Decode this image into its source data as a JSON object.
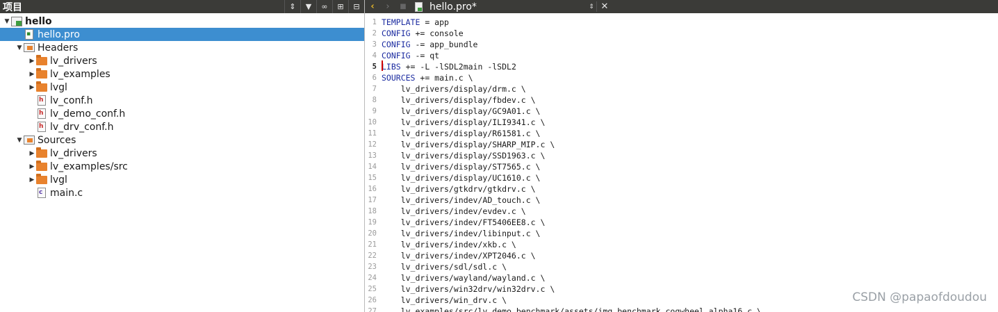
{
  "project_panel": {
    "title": "项目",
    "toolbar_icons": [
      "sort-spinner-icon",
      "filter-icon",
      "link-icon",
      "split-icon",
      "collapse-icon"
    ],
    "tree": [
      {
        "label": "hello",
        "depth": 0,
        "expand": "open",
        "icon": "project",
        "bold": true
      },
      {
        "label": "hello.pro",
        "depth": 1,
        "expand": "none",
        "icon": "pro-file",
        "selected": true
      },
      {
        "label": "Headers",
        "depth": 1,
        "expand": "open",
        "icon": "virtual-folder"
      },
      {
        "label": "lv_drivers",
        "depth": 2,
        "expand": "closed",
        "icon": "folder"
      },
      {
        "label": "lv_examples",
        "depth": 2,
        "expand": "closed",
        "icon": "folder"
      },
      {
        "label": "lvgl",
        "depth": 2,
        "expand": "closed",
        "icon": "folder"
      },
      {
        "label": "lv_conf.h",
        "depth": 2,
        "expand": "none",
        "icon": "h-file"
      },
      {
        "label": "lv_demo_conf.h",
        "depth": 2,
        "expand": "none",
        "icon": "h-file"
      },
      {
        "label": "lv_drv_conf.h",
        "depth": 2,
        "expand": "none",
        "icon": "h-file"
      },
      {
        "label": "Sources",
        "depth": 1,
        "expand": "open",
        "icon": "virtual-folder"
      },
      {
        "label": "lv_drivers",
        "depth": 2,
        "expand": "closed",
        "icon": "folder"
      },
      {
        "label": "lv_examples/src",
        "depth": 2,
        "expand": "closed",
        "icon": "folder"
      },
      {
        "label": "lvgl",
        "depth": 2,
        "expand": "closed",
        "icon": "folder"
      },
      {
        "label": "main.c",
        "depth": 2,
        "expand": "none",
        "icon": "c-file"
      }
    ]
  },
  "editor": {
    "tab_title": "hello.pro*",
    "current_line": 5,
    "lines": [
      {
        "n": "1",
        "kw": "TEMPLATE",
        "rest": " = app"
      },
      {
        "n": "2",
        "kw": "CONFIG",
        "rest": " += console"
      },
      {
        "n": "3",
        "kw": "CONFIG",
        "rest": " -= app_bundle"
      },
      {
        "n": "4",
        "kw": "CONFIG",
        "rest": " -= qt"
      },
      {
        "n": "5",
        "kw": "LIBS",
        "rest": " += -L -lSDL2main -lSDL2"
      },
      {
        "n": "6",
        "kw": "SOURCES",
        "rest": " += main.c \\"
      },
      {
        "n": "7",
        "kw": "",
        "rest": "    lv_drivers/display/drm.c \\"
      },
      {
        "n": "8",
        "kw": "",
        "rest": "    lv_drivers/display/fbdev.c \\"
      },
      {
        "n": "9",
        "kw": "",
        "rest": "    lv_drivers/display/GC9A01.c \\"
      },
      {
        "n": "10",
        "kw": "",
        "rest": "    lv_drivers/display/ILI9341.c \\"
      },
      {
        "n": "11",
        "kw": "",
        "rest": "    lv_drivers/display/R61581.c \\"
      },
      {
        "n": "12",
        "kw": "",
        "rest": "    lv_drivers/display/SHARP_MIP.c \\"
      },
      {
        "n": "13",
        "kw": "",
        "rest": "    lv_drivers/display/SSD1963.c \\"
      },
      {
        "n": "14",
        "kw": "",
        "rest": "    lv_drivers/display/ST7565.c \\"
      },
      {
        "n": "15",
        "kw": "",
        "rest": "    lv_drivers/display/UC1610.c \\"
      },
      {
        "n": "16",
        "kw": "",
        "rest": "    lv_drivers/gtkdrv/gtkdrv.c \\"
      },
      {
        "n": "17",
        "kw": "",
        "rest": "    lv_drivers/indev/AD_touch.c \\"
      },
      {
        "n": "18",
        "kw": "",
        "rest": "    lv_drivers/indev/evdev.c \\"
      },
      {
        "n": "19",
        "kw": "",
        "rest": "    lv_drivers/indev/FT5406EE8.c \\"
      },
      {
        "n": "20",
        "kw": "",
        "rest": "    lv_drivers/indev/libinput.c \\"
      },
      {
        "n": "21",
        "kw": "",
        "rest": "    lv_drivers/indev/xkb.c \\"
      },
      {
        "n": "22",
        "kw": "",
        "rest": "    lv_drivers/indev/XPT2046.c \\"
      },
      {
        "n": "23",
        "kw": "",
        "rest": "    lv_drivers/sdl/sdl.c \\"
      },
      {
        "n": "24",
        "kw": "",
        "rest": "    lv_drivers/wayland/wayland.c \\"
      },
      {
        "n": "25",
        "kw": "",
        "rest": "    lv_drivers/win32drv/win32drv.c \\"
      },
      {
        "n": "26",
        "kw": "",
        "rest": "    lv_drivers/win_drv.c \\"
      },
      {
        "n": "27",
        "kw": "",
        "rest": "    lv_examples/src/lv_demo_benchmark/assets/img_benchmark_cogwheel_alpha16.c \\"
      }
    ]
  },
  "watermark": "CSDN @papaofdoudou",
  "colors": {
    "selection": "#3d8ed0",
    "toolbar": "#3b3b38",
    "keyword": "#1b2ba0",
    "folder": "#e8822d"
  }
}
